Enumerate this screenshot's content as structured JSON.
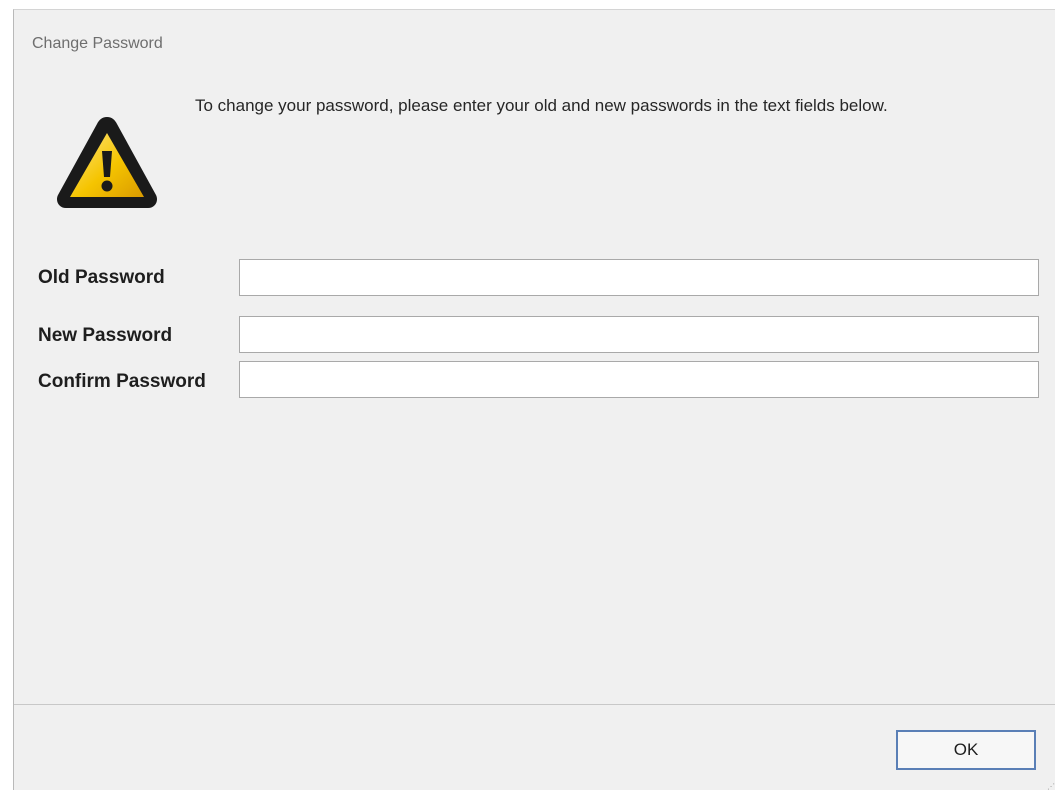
{
  "dialog": {
    "title": "Change Password",
    "message": "To change your password, please enter your old and new passwords in the text fields below.",
    "icon": "warning-triangle-icon"
  },
  "fields": {
    "old_password": {
      "label": "Old Password",
      "value": "",
      "placeholder": ""
    },
    "new_password": {
      "label": "New Password",
      "value": "",
      "placeholder": ""
    },
    "confirm_password": {
      "label": "Confirm Password",
      "value": "",
      "placeholder": ""
    }
  },
  "buttons": {
    "ok_label": "OK"
  },
  "colors": {
    "dialog_background": "#f0f0f0",
    "warning_yellow": "#f5c400",
    "warning_outline": "#1a1a1a",
    "button_border": "#5a7fb6"
  }
}
